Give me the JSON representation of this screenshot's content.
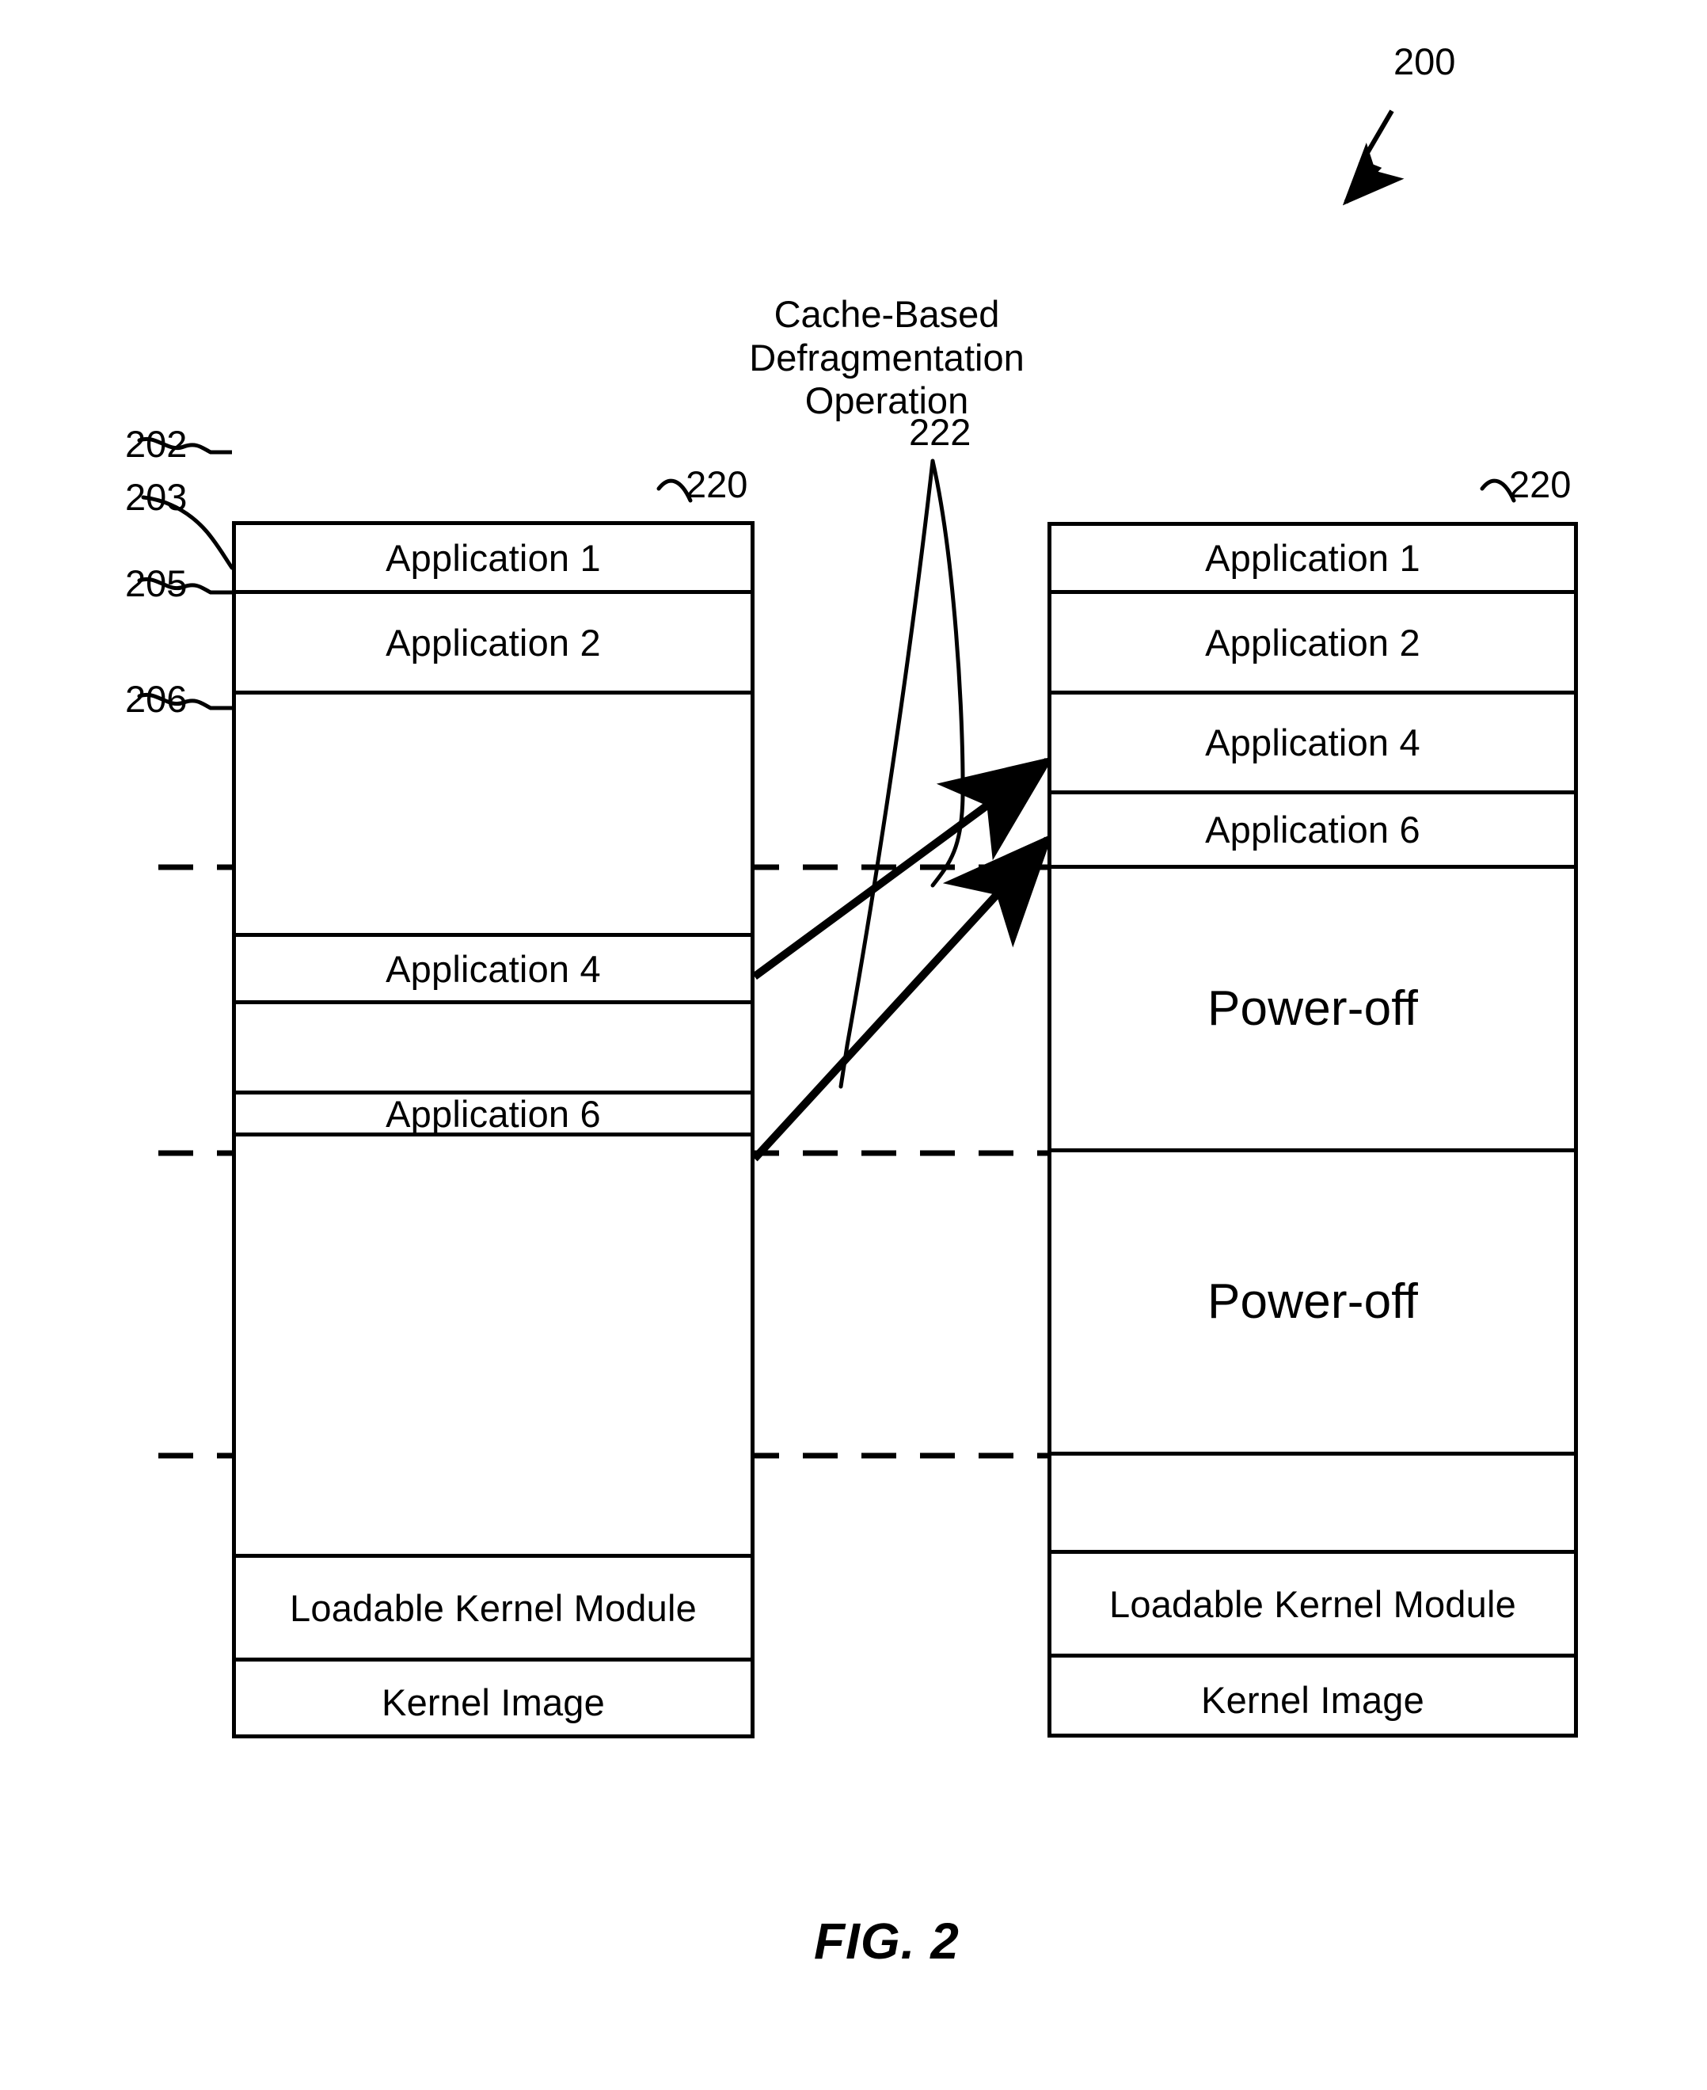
{
  "figure": {
    "caption": "FIG. 2",
    "ref_main": "200"
  },
  "operation": {
    "label": "Cache-Based\nDefragmentation\nOperation",
    "ref": "222"
  },
  "before_column": {
    "ref": "220",
    "segments": [
      {
        "label": "Application 1",
        "ref": ""
      },
      {
        "label": "Application 2",
        "ref": ""
      },
      {
        "label": "",
        "ref": "202"
      },
      {
        "label": "",
        "ref": ""
      },
      {
        "label": "Application 4",
        "ref": "205"
      },
      {
        "label": "",
        "ref": ""
      },
      {
        "label": "Application 6",
        "ref": "206"
      },
      {
        "label": "",
        "ref": ""
      },
      {
        "label": "Loadable Kernel Module",
        "ref": ""
      },
      {
        "label": "Kernel Image",
        "ref": ""
      }
    ]
  },
  "after_column": {
    "ref": "220",
    "segments": [
      {
        "label": "Application 1"
      },
      {
        "label": "Application 2"
      },
      {
        "label": "Application 4"
      },
      {
        "label": "Application 6"
      },
      {
        "label": "Power-off"
      },
      {
        "label": "Power-off"
      },
      {
        "label": ""
      },
      {
        "label": "Loadable Kernel Module"
      },
      {
        "label": "Kernel Image"
      }
    ]
  },
  "boundary_refs": {
    "block_boundary_upper": "203",
    "block_boundary_mid": "206"
  },
  "colors": {
    "ink": "#000000",
    "paper": "#ffffff"
  }
}
